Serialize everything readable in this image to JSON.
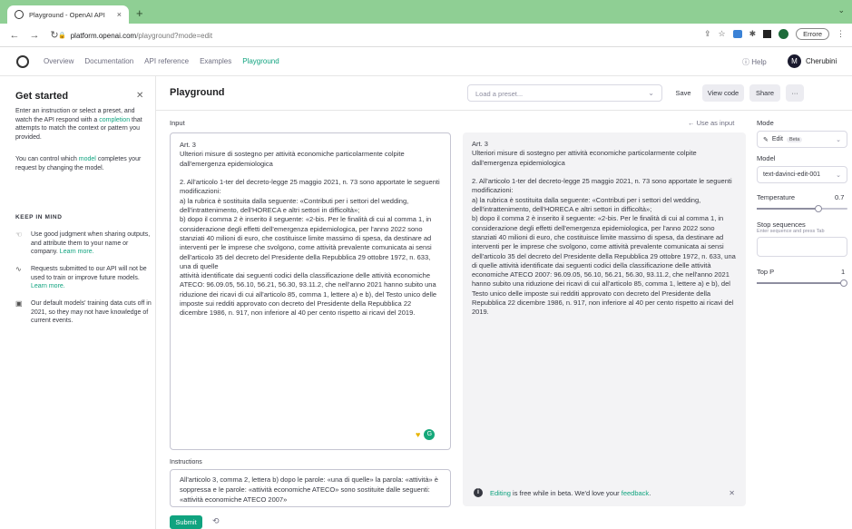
{
  "browser": {
    "tab_title": "Playground - OpenAI API",
    "url_host": "platform.openai.com",
    "url_path": "/playground?mode=edit",
    "error_label": "Errore"
  },
  "nav": {
    "links": [
      "Overview",
      "Documentation",
      "API reference",
      "Examples",
      "Playground"
    ],
    "help": "Help",
    "avatar_initial": "M",
    "username": "Cherubini"
  },
  "sidebar": {
    "title": "Get started",
    "intro_pre": "Enter an instruction or select a preset, and watch the API respond with a",
    "intro_link": "completion",
    "intro_post": "that attempts to match the context or pattern you provided.",
    "control_pre": "You can control which",
    "control_link": "model",
    "control_post": "completes your request by changing the model.",
    "keep_heading": "KEEP IN MIND",
    "tips": [
      {
        "icon": "thumbs-up-icon",
        "glyph": "☜",
        "text": "Use good judgment when sharing outputs, and attribute them to your name or company.",
        "link": "Learn more."
      },
      {
        "icon": "activity-icon",
        "glyph": "∿",
        "text": "Requests submitted to our API will not be used to train or improve future models.",
        "link": "Learn more."
      },
      {
        "icon": "calendar-icon",
        "glyph": "▣",
        "text": "Our default models' training data cuts off in 2021, so they may not have knowledge of current events.",
        "link": ""
      }
    ]
  },
  "header": {
    "title": "Playground",
    "preset_placeholder": "Load a preset...",
    "save": "Save",
    "view_code": "View code",
    "share": "Share",
    "more": "···"
  },
  "editor": {
    "input_label": "Input",
    "use_as_input": "← Use as input",
    "input_text": "Art. 3\nUlteriori misure di sostegno per attività economiche particolarmente colpite dall'emergenza epidemiologica\n\n2. All'articolo 1-ter del decreto-legge 25 maggio 2021, n. 73 sono apportate le seguenti modificazioni:\na) la rubrica è sostituita dalla seguente: «Contributi per i settori del wedding, dell'intrattenimento, dell'HORECA e altri settori in difficoltà»;\nb) dopo il comma 2 è inserito il seguente: «2-bis. Per le finalità di cui al comma 1, in considerazione degli effetti dell'emergenza epidemiologica, per l'anno 2022 sono stanziati 40 milioni di euro, che costituisce limite massimo di spesa, da destinare ad interventi per le imprese che svolgono, come attività prevalente comunicata ai sensi dell'articolo 35 del decreto del Presidente della Repubblica 29 ottobre 1972, n. 633, una di quelle\nattività identificate dai seguenti codici della classificazione delle attività economiche ATECO: 96.09.05, 56.10, 56.21, 56.30, 93.11.2, che nell'anno 2021 hanno subito una riduzione dei ricavi di cui all'articolo 85, comma 1, lettere a) e b), del Testo unico delle imposte sui redditi approvato con decreto del Presidente della Repubblica 22 dicembre 1986, n. 917, non inferiore al 40 per cento rispetto ai ricavi del 2019.",
    "output_text": "Art. 3\nUlteriori misure di sostegno per attività economiche particolarmente colpite dall'emergenza epidemiologica\n\n2. All'articolo 1-ter del decreto-legge 25 maggio 2021, n. 73 sono apportate le seguenti modificazioni:\na) la rubrica è sostituita dalla seguente: «Contributi per i settori del wedding, dell'intrattenimento, dell'HORECA e altri settori in difficoltà»;\nb) dopo il comma 2 è inserito il seguente: «2-bis. Per le finalità di cui al comma 1, in considerazione degli effetti dell'emergenza epidemiologica, per l'anno 2022 sono stanziati 40 milioni di euro, che costituisce limite massimo di spesa, da destinare ad interventi per le imprese che svolgono, come attività prevalente comunicata ai sensi dell'articolo 35 del decreto del Presidente della Repubblica 29 ottobre 1972, n. 633, una di quelle attività identificate dai seguenti codici della classificazione delle attività economiche ATECO 2007: 96.09.05, 56.10, 56.21, 56.30, 93.11.2, che nell'anno 2021 hanno subito una riduzione dei ricavi di cui all'articolo 85, comma 1, lettere a) e b), del Testo unico delle imposte sui redditi approvato con decreto del Presidente della Repubblica 22 dicembre 1986, n. 917, non inferiore al 40 per cento rispetto ai ricavi del 2019.",
    "instructions_label": "Instructions",
    "instructions_text": "All'articolo 3, comma 2, lettera b) dopo le parole: «una di quelle» la parola: «attività» è soppressa e le parole: «attività economiche ATECO» sono sostituite dalle seguenti: «attività economiche ATECO 2007»",
    "submit": "Submit"
  },
  "toast": {
    "link": "Editing",
    "mid": "is free while in beta. We'd love your",
    "feedback": "feedback",
    "end": "."
  },
  "settings": {
    "mode_label": "Mode",
    "mode_value": "Edit",
    "mode_badge": "Beta",
    "model_label": "Model",
    "model_value": "text-davinci-edit-001",
    "temperature_label": "Temperature",
    "temperature_value": "0.7",
    "temperature_level": 0.7,
    "stop_label": "Stop sequences",
    "stop_sub": "Enter sequence and press Tab",
    "top_p_label": "Top P",
    "top_p_value": "1",
    "top_p_level": 1.0
  }
}
